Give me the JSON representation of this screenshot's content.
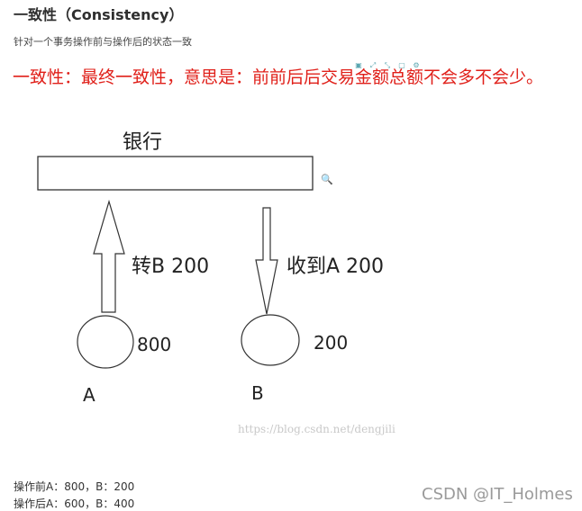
{
  "heading": "一致性（Consistency）",
  "subtitle": "针对一个事务操作前与操作后的状态一致",
  "note": "一致性：最终一致性，意思是：前前后后交易金额总额不会多不会少。",
  "diagram": {
    "bank_label": "银行",
    "transfer_label": "转B 200",
    "receive_label": "收到A 200",
    "node_a_value": "800",
    "node_b_value": "200",
    "node_a_label": "A",
    "node_b_label": "B"
  },
  "image_url_watermark": "https://blog.csdn.net/dengjili",
  "before_op": "操作前A：800，B：200",
  "after_op": "操作后A：600，B：400",
  "csdn_watermark": "CSDN @IT_Holmes"
}
